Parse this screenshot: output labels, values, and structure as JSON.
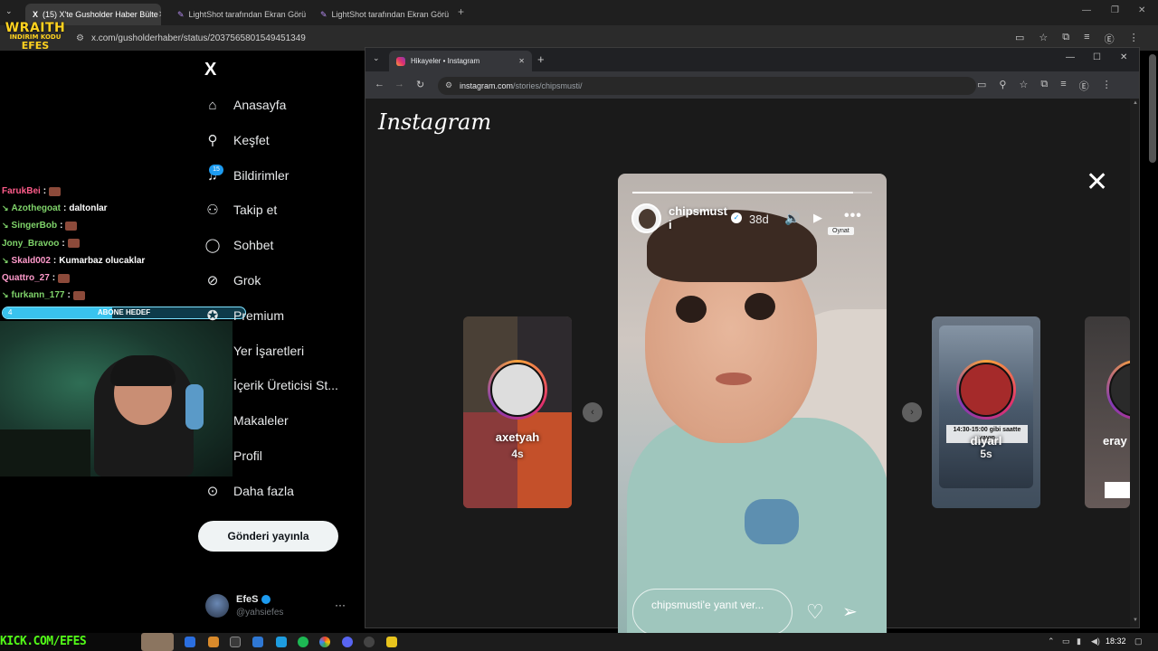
{
  "outer_browser": {
    "tabs": [
      {
        "label": "(15) X'te Gusholder Haber Bülte",
        "active": true
      },
      {
        "label": "LightShot tarafından Ekran Görü",
        "active": false
      },
      {
        "label": "LightShot tarafından Ekran Görü",
        "active": false
      }
    ],
    "url": "x.com/gusholderhaber/status/2037565801549451349"
  },
  "overlay": {
    "wraith_title": "WRAITH",
    "wraith_sub": "INDIRIM KODU",
    "wraith_code": "EFES",
    "chat": [
      {
        "user": "FarukBei",
        "color": "#ff5c8a",
        "message": "",
        "badge": ""
      },
      {
        "user": "Azothegoat",
        "color": "#7fd36a",
        "message": "daltonlar",
        "badge": "↘"
      },
      {
        "user": "SingerBob",
        "color": "#7fd36a",
        "message": "",
        "badge": "↘"
      },
      {
        "user": "Jony_Bravoo",
        "color": "#7fd36a",
        "message": "",
        "badge": ""
      },
      {
        "user": "Skald002",
        "color": "#ff9acb",
        "message": "Kumarbaz olucaklar",
        "badge": "↘"
      },
      {
        "user": "Quattro_27",
        "color": "#ff9acb",
        "message": "",
        "badge": ""
      },
      {
        "user": "furkann_177",
        "color": "#7fd36a",
        "message": "",
        "badge": "↘"
      }
    ],
    "goal": {
      "label": "ABONE HEDEF",
      "current": "4",
      "progress": 0.45
    },
    "kick_text": "KICK.COM/EFES"
  },
  "x_sidebar": {
    "logo": "X",
    "notif_count": "15",
    "items": [
      {
        "label": "Anasayfa",
        "icon": "home-icon",
        "glyph": "⌂"
      },
      {
        "label": "Keşfet",
        "icon": "search-icon",
        "glyph": "⚲"
      },
      {
        "label": "Bildirimler",
        "icon": "bell-icon",
        "glyph": "♫"
      },
      {
        "label": "Takip et",
        "icon": "add-person-icon",
        "glyph": "⚇"
      },
      {
        "label": "Sohbet",
        "icon": "chat-bubble-icon",
        "glyph": "◯"
      },
      {
        "label": "Grok",
        "icon": "grok-icon",
        "glyph": "⊘"
      },
      {
        "label": "Premium",
        "icon": "premium-icon",
        "glyph": "✪"
      },
      {
        "label": "Yer İşaretleri",
        "icon": "bookmark-icon",
        "glyph": ""
      },
      {
        "label": "İçerik Üreticisi St...",
        "icon": "creator-studio-icon",
        "glyph": ""
      },
      {
        "label": "Makaleler",
        "icon": "articles-icon",
        "glyph": ""
      },
      {
        "label": "Profil",
        "icon": "profile-icon",
        "glyph": ""
      },
      {
        "label": "Daha fazla",
        "icon": "more-circle-icon",
        "glyph": "⊙"
      }
    ],
    "post_button": "Gönderi yayınla",
    "profile": {
      "name": "EfeS",
      "handle": "@yahsiefes",
      "more": "···"
    }
  },
  "inner_browser": {
    "tab_title": "Hikayeler • Instagram",
    "url_host": "instagram.com",
    "url_path": "/stories/chipsmusti/"
  },
  "instagram": {
    "logo": "Instagram",
    "close": "✕",
    "story": {
      "username": "chipsmust i",
      "age": "38d",
      "progress": 0.92,
      "tooltip": "Oynat",
      "reply_placeholder": "chipsmusti'e yanıt ver...",
      "sound_icon": "🔊",
      "play_icon": "▶",
      "more_icon": "•••",
      "heart_icon": "♡",
      "share_icon": "➢"
    },
    "prev_card": {
      "name": "axetyah",
      "time": "4s"
    },
    "next_card": {
      "name": "diyarl",
      "time": "5s",
      "overlay_text": "14:30-15:00 gibi saatte yayın"
    },
    "far_card": {
      "name": "eray"
    },
    "prev_arrow": "‹",
    "next_arrow": "›"
  },
  "taskbar": {
    "time": "18:32"
  }
}
